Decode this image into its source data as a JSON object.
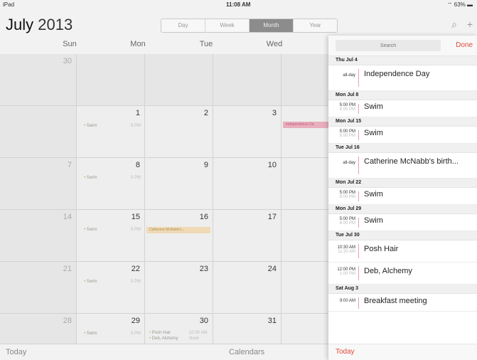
{
  "status": {
    "device": "iPad",
    "time": "11:08 AM",
    "battery": "63%"
  },
  "header": {
    "month": "July",
    "year": "2013"
  },
  "view_modes": [
    {
      "label": "Day",
      "active": false
    },
    {
      "label": "Week",
      "active": false
    },
    {
      "label": "Month",
      "active": true
    },
    {
      "label": "Year",
      "active": false
    }
  ],
  "weekdays": [
    "Sun",
    "Mon",
    "Tue",
    "Wed"
  ],
  "calendar": {
    "weeks": [
      [
        "30",
        "",
        "",
        ""
      ],
      [
        "",
        "1",
        "2",
        "3"
      ],
      [
        "7",
        "8",
        "9",
        "10"
      ],
      [
        "14",
        "15",
        "16",
        "17"
      ],
      [
        "21",
        "22",
        "23",
        "24"
      ],
      [
        "28",
        "29",
        "30",
        "31"
      ]
    ],
    "swim_label": "Swim",
    "swim_time": "5 PM",
    "independence_bar": "Independence Da",
    "catherine_bar": "Catherine McNabb's...",
    "posh": "Posh Hair",
    "posh_time": "10:30 AM",
    "deb": "Deb, Alchemy",
    "deb_time": "Noon"
  },
  "footer": {
    "today": "Today",
    "calendars": "Calendars"
  },
  "popover": {
    "search_placeholder": "Search",
    "done": "Done",
    "today": "Today",
    "groups": [
      {
        "date": "Thu Jul 4",
        "events": [
          {
            "start": "all-day",
            "end": "",
            "title": "Independence Day"
          }
        ]
      },
      {
        "date": "Mon Jul 8",
        "events": [
          {
            "start": "5:00 PM",
            "end": "6:00 PM",
            "title": "Swim"
          }
        ]
      },
      {
        "date": "Mon Jul 15",
        "events": [
          {
            "start": "5:00 PM",
            "end": "6:00 PM",
            "title": "Swim"
          }
        ]
      },
      {
        "date": "Tue Jul 16",
        "events": [
          {
            "start": "all-day",
            "end": "",
            "title": "Catherine McNabb's birth..."
          }
        ]
      },
      {
        "date": "Mon Jul 22",
        "events": [
          {
            "start": "5:00 PM",
            "end": "6:00 PM",
            "title": "Swim"
          }
        ]
      },
      {
        "date": "Mon Jul 29",
        "events": [
          {
            "start": "5:00 PM",
            "end": "6:00 PM",
            "title": "Swim"
          }
        ]
      },
      {
        "date": "Tue Jul 30",
        "events": [
          {
            "start": "10:30 AM",
            "end": "11:30 AM",
            "title": "Posh Hair"
          },
          {
            "start": "12:00 PM",
            "end": "1:00 PM",
            "title": "Deb, Alchemy"
          }
        ]
      },
      {
        "date": "Sat Aug 3",
        "events": [
          {
            "start": "9:00 AM",
            "end": "",
            "title": "Breakfast meeting"
          }
        ]
      }
    ]
  }
}
